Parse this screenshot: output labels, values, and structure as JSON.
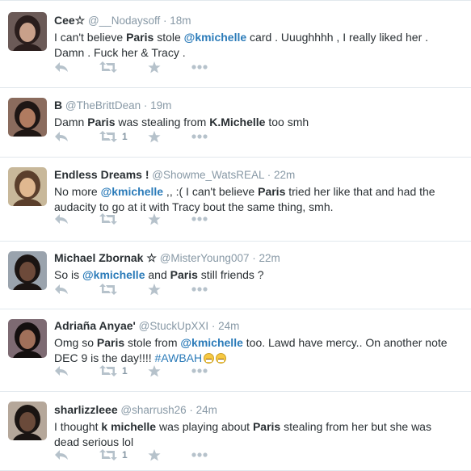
{
  "tweets": [
    {
      "fullname": "Cee☆",
      "username": "@__Nodaysoff",
      "time": "18m",
      "line1": [
        {
          "t": "I can't believe "
        },
        {
          "t": "Paris",
          "b": true
        },
        {
          "t": " stole "
        },
        {
          "t": "@kmichelle",
          "m": true
        },
        {
          "t": " card . Uuughhhh , I really liked her ."
        }
      ],
      "line2": [
        {
          "t": "Damn . Fuck her & Tracy ."
        }
      ],
      "retweets": ""
    },
    {
      "fullname": "B",
      "username": "@TheBrittDean",
      "time": "19m",
      "line1": [
        {
          "t": "Damn "
        },
        {
          "t": "Paris",
          "b": true
        },
        {
          "t": " was stealing from "
        },
        {
          "t": "K.Michelle",
          "b": true
        },
        {
          "t": " too smh"
        }
      ],
      "line2": [],
      "retweets": "1"
    },
    {
      "fullname": "Endless Dreams !",
      "username": "@Showme_WatsREAL",
      "time": "22m",
      "line1": [
        {
          "t": "No more "
        },
        {
          "t": "@kmichelle",
          "m": true
        },
        {
          "t": " ,, :( I can't believe "
        },
        {
          "t": "Paris",
          "b": true
        },
        {
          "t": " tried her like that and had the"
        }
      ],
      "line2": [
        {
          "t": "audacity to go at it with Tracy bout the same thing, smh."
        }
      ],
      "retweets": ""
    },
    {
      "fullname": "Michael Zbornak ☆",
      "username": "@MisterYoung007",
      "time": "22m",
      "line1": [
        {
          "t": "So is "
        },
        {
          "t": "@kmichelle",
          "m": true
        },
        {
          "t": " and "
        },
        {
          "t": "Paris",
          "b": true
        },
        {
          "t": " still friends ?"
        }
      ],
      "line2": [],
      "retweets": ""
    },
    {
      "fullname": "Adriaña Anyae'",
      "username": "@StuckUpXXI",
      "time": "24m",
      "line1": [
        {
          "t": "Omg so "
        },
        {
          "t": "Paris",
          "b": true
        },
        {
          "t": " stole from "
        },
        {
          "t": "@kmichelle",
          "m": true
        },
        {
          "t": " too. Lawd have mercy..  On another note"
        }
      ],
      "line2": [
        {
          "t": "DEC 9 is the day!!!! "
        },
        {
          "t": "#AWBAH",
          "h": true
        },
        {
          "t": "",
          "emoji": 2
        }
      ],
      "retweets": "1"
    },
    {
      "fullname": "sharlizzleee",
      "username": "@sharrush26",
      "time": "24m",
      "line1": [
        {
          "t": "I thought "
        },
        {
          "t": "k michelle",
          "b": true
        },
        {
          "t": " was playing about "
        },
        {
          "t": "Paris",
          "b": true
        },
        {
          "t": " stealing from her but she was"
        }
      ],
      "line2": [
        {
          "t": "dead serious lol"
        }
      ],
      "retweets": "1"
    }
  ],
  "icons": {
    "reply": "reply-icon",
    "retweet": "retweet-icon",
    "favorite": "star-icon",
    "more": "more-icon"
  },
  "colors": {
    "name": "#292f33",
    "meta": "#8899a6",
    "link": "#2b7bb9",
    "action": "#b6c2cb",
    "divider": "#e1e8ed"
  }
}
